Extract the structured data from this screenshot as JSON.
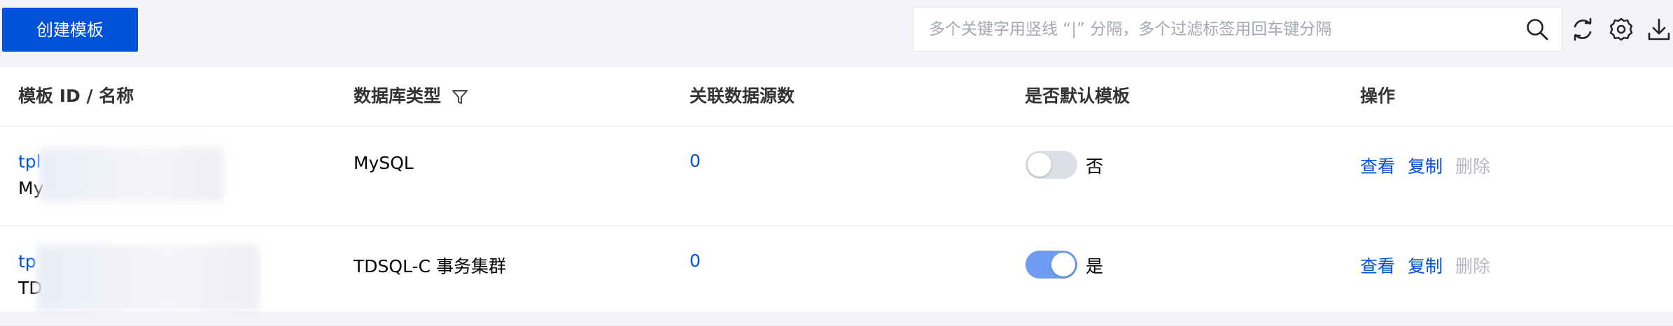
{
  "toolbar": {
    "create_label": "创建模板",
    "search_placeholder": "多个关键字用竖线 “|” 分隔，多个过滤标签用回车键分隔"
  },
  "icons": {
    "search": "search-icon",
    "refresh": "refresh-icon",
    "settings": "gear-icon",
    "download": "download-icon",
    "filter": "filter-icon"
  },
  "colors": {
    "primary": "#0052d9",
    "toggle_on": "#6f9cf2",
    "toggle_off": "#dcdfe5",
    "disabled_text": "#b5b8bf"
  },
  "table": {
    "columns": [
      "模板 ID / 名称",
      "数据库类型",
      "关联数据源数",
      "是否默认模板",
      "操作"
    ],
    "rows": [
      {
        "id_prefix": "tpl",
        "name_prefix": "My",
        "db_type": "MySQL",
        "source_count": "0",
        "is_default": false,
        "default_label": "否",
        "actions": {
          "view": "查看",
          "copy": "复制",
          "delete": "删除"
        }
      },
      {
        "id_prefix": "tp",
        "name_prefix": "TD",
        "db_type": "TDSQL-C 事务集群",
        "source_count": "0",
        "is_default": true,
        "default_label": "是",
        "actions": {
          "view": "查看",
          "copy": "复制",
          "delete": "删除"
        }
      }
    ]
  }
}
